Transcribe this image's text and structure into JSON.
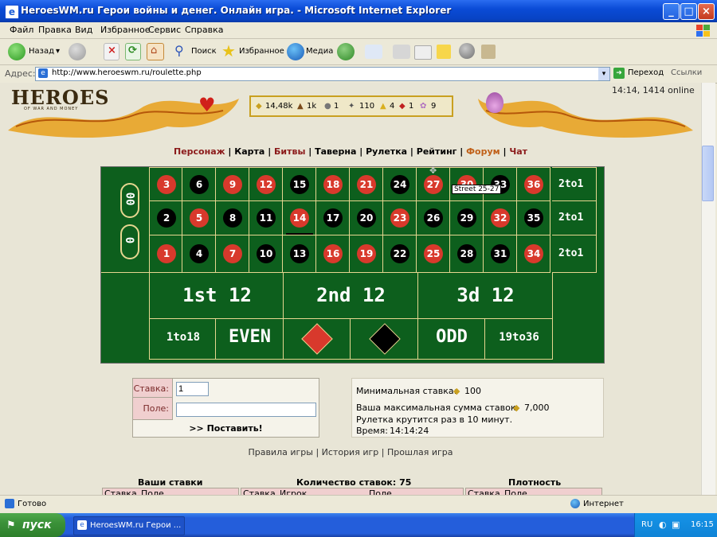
{
  "window": {
    "title": "HeroesWM.ru Герои войны и денег. Онлайн игра. - Microsoft Internet Explorer",
    "controls": [
      "_",
      "□",
      "×"
    ]
  },
  "menu": [
    "Файл",
    "Правка",
    "Вид",
    "Избранное",
    "Сервис",
    "Справка"
  ],
  "toolbar": {
    "back": "Назад",
    "search": "Поиск",
    "favorites": "Избранное",
    "media": "Медиа"
  },
  "address": {
    "label": "Адрес:",
    "url": "http://www.heroeswm.ru/roulette.php",
    "go": "Переход",
    "links": "Ссылки"
  },
  "header": {
    "logo": "HEROES",
    "logo_sub": "OF WAR AND MONEY",
    "resources": [
      "14,48k",
      "1k",
      "1",
      "110",
      "4",
      "1",
      "9"
    ],
    "clock": "14:14, 1414 online"
  },
  "nav": [
    "Персонаж",
    "Карта",
    "Битвы",
    "Таверна",
    "Рулетка",
    "Рейтинг",
    "Форум",
    "Чат"
  ],
  "roulette": {
    "zero": "0",
    "double_zero": "00",
    "rows": [
      [
        {
          "n": "3",
          "c": "red"
        },
        {
          "n": "6",
          "c": "blk"
        },
        {
          "n": "9",
          "c": "red"
        },
        {
          "n": "12",
          "c": "red"
        },
        {
          "n": "15",
          "c": "blk"
        },
        {
          "n": "18",
          "c": "red"
        },
        {
          "n": "21",
          "c": "red"
        },
        {
          "n": "24",
          "c": "blk"
        },
        {
          "n": "27",
          "c": "red"
        },
        {
          "n": "30",
          "c": "red"
        },
        {
          "n": "33",
          "c": "blk"
        },
        {
          "n": "36",
          "c": "red"
        }
      ],
      [
        {
          "n": "2",
          "c": "blk"
        },
        {
          "n": "5",
          "c": "red"
        },
        {
          "n": "8",
          "c": "blk"
        },
        {
          "n": "11",
          "c": "blk"
        },
        {
          "n": "14",
          "c": "red"
        },
        {
          "n": "17",
          "c": "blk"
        },
        {
          "n": "20",
          "c": "blk"
        },
        {
          "n": "23",
          "c": "red"
        },
        {
          "n": "26",
          "c": "blk"
        },
        {
          "n": "29",
          "c": "blk"
        },
        {
          "n": "32",
          "c": "red"
        },
        {
          "n": "35",
          "c": "blk"
        }
      ],
      [
        {
          "n": "1",
          "c": "red"
        },
        {
          "n": "4",
          "c": "blk"
        },
        {
          "n": "7",
          "c": "red"
        },
        {
          "n": "10",
          "c": "blk"
        },
        {
          "n": "13",
          "c": "blk"
        },
        {
          "n": "16",
          "c": "red"
        },
        {
          "n": "19",
          "c": "red"
        },
        {
          "n": "22",
          "c": "blk"
        },
        {
          "n": "25",
          "c": "red"
        },
        {
          "n": "28",
          "c": "blk"
        },
        {
          "n": "31",
          "c": "blk"
        },
        {
          "n": "34",
          "c": "red"
        }
      ]
    ],
    "column_bets": [
      "2to1",
      "2to1",
      "2to1"
    ],
    "dozens": [
      "1st 12",
      "2nd 12",
      "3d 12"
    ],
    "outside": [
      "1to18",
      "EVEN",
      "ODD",
      "19to36"
    ],
    "tooltip": "Street 25-27"
  },
  "bet_form": {
    "stake_label": "Ставка:",
    "stake_value": "1",
    "field_label": "Поле:",
    "field_value": "",
    "submit": ">> Поставить!"
  },
  "info": {
    "min_bet": "Минимальная ставка:",
    "min_bet_value": "100",
    "max_sum": "Ваша максимальная сумма ставок:",
    "max_sum_value": "7,000",
    "spin": "Рулетка крутится раз в 10 минут.",
    "time_label": "Время:",
    "time_value": "14:14:24"
  },
  "links": [
    "Правила игры",
    "История игр",
    "Прошлая игра"
  ],
  "bets_section": {
    "your_bets": "Ваши ставки",
    "count": "Количество ставок: 75",
    "density": "Плотность",
    "col_stake": "Ставка",
    "col_field": "Поле",
    "col_player": "Игрок"
  },
  "statusbar": {
    "text": "Готово",
    "zone": "Интернет"
  },
  "taskbar": {
    "start": "пуск",
    "task": "HeroesWM.ru Герои ...",
    "lang": "RU",
    "time": "16:15"
  },
  "colors": {
    "red": "#d8392c",
    "black": "#000000",
    "felt": "#0d5f1d",
    "nav": "#8b1a1a"
  }
}
